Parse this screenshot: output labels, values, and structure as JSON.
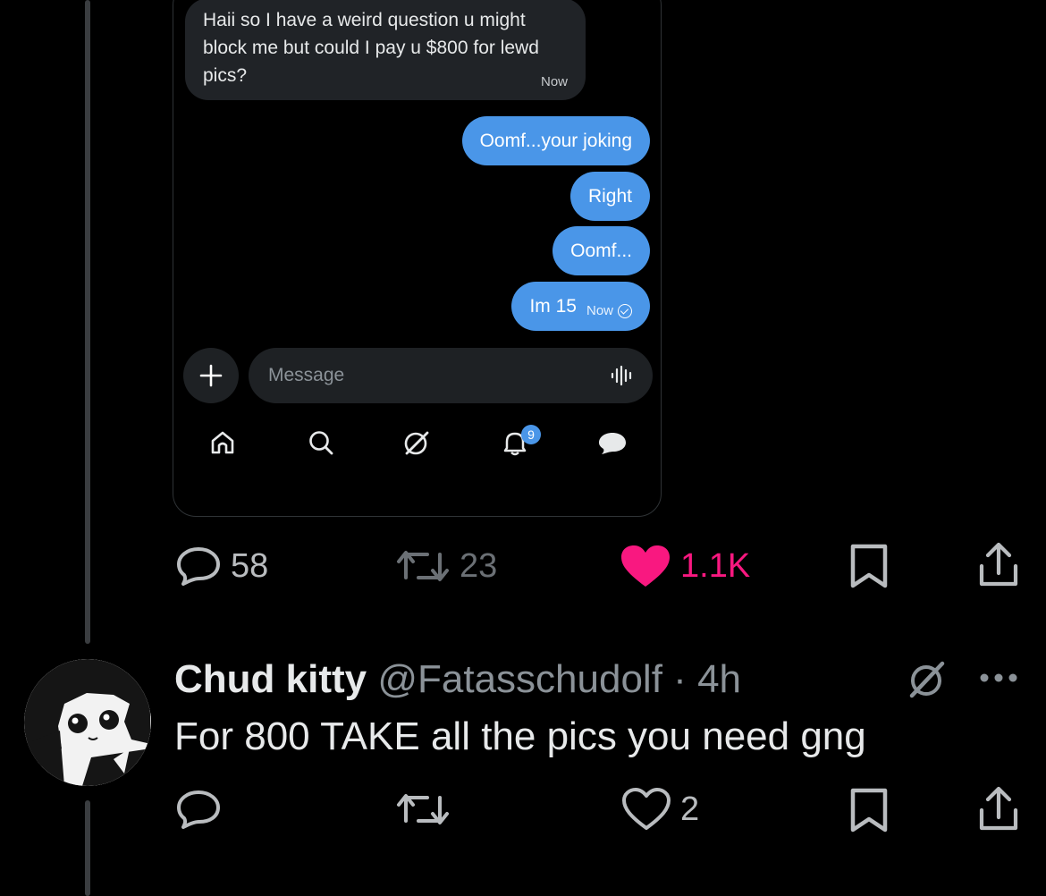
{
  "dm": {
    "incoming_message": "Haii so I have a weird question u might block me but could I pay u $800 for lewd pics?",
    "incoming_time": "Now",
    "outgoing": [
      {
        "text": "Oomf...your joking"
      },
      {
        "text": "Right"
      },
      {
        "text": "Oomf..."
      },
      {
        "text": "Im 15"
      }
    ],
    "last_time": "Now",
    "composer_placeholder": "Message",
    "notification_badge": "9"
  },
  "post_actions": {
    "replies": "58",
    "reposts": "23",
    "likes": "1.1K"
  },
  "reply": {
    "name": "Chud kitty",
    "handle": "@Fatasschudolf",
    "separator": "·",
    "time": "4h",
    "text": "For 800 TAKE all the pics you need gng",
    "likes": "2"
  },
  "colors": {
    "accent_blue": "#4a96e8",
    "like_pink": "#f91880",
    "background": "#000000"
  }
}
